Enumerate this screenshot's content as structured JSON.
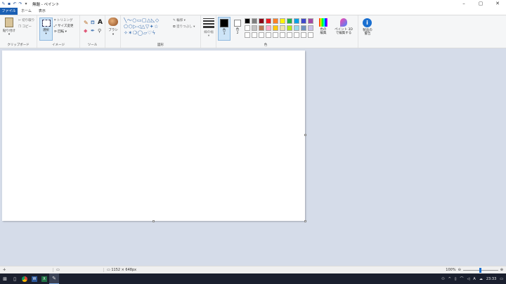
{
  "window": {
    "title": "無題 - ペイント"
  },
  "tabs": {
    "file": "ファイル",
    "home": "ホーム",
    "view": "表示"
  },
  "clipboard": {
    "paste": "貼り付け",
    "cut": "切り取り",
    "copy": "コピー",
    "label": "クリップボード"
  },
  "image": {
    "select": "選択",
    "crop": "トリミング",
    "resize": "サイズ変更",
    "rotate": "回転",
    "label": "イメージ"
  },
  "tools": {
    "label": "ツール"
  },
  "brushes": {
    "label": "ブラシ"
  },
  "shapes": {
    "outline": "輪郭",
    "fill": "塗りつぶし",
    "label": "図形"
  },
  "size": {
    "label": "線の幅"
  },
  "colors": {
    "color1": "色\n1",
    "color2": "色\n2",
    "edit": "色の\n編集",
    "label": "色",
    "color1_value": "#000000",
    "color2_value": "#ffffff",
    "palette_row1": [
      "#000000",
      "#7f7f7f",
      "#880015",
      "#ed1c24",
      "#ff7f27",
      "#fff200",
      "#22b14c",
      "#00a2e8",
      "#3f48cc",
      "#a349a4"
    ],
    "palette_row2": [
      "#ffffff",
      "#c3c3c3",
      "#b97a57",
      "#ffaec9",
      "#ffc90e",
      "#efe4b0",
      "#b5e61d",
      "#99d9ea",
      "#7092be",
      "#c8bfe7"
    ],
    "palette_row3": [
      "#ffffff",
      "#ffffff",
      "#ffffff",
      "#ffffff",
      "#ffffff",
      "#ffffff",
      "#ffffff",
      "#ffffff",
      "#ffffff",
      "#ffffff"
    ]
  },
  "paint3d": {
    "label": "ペイント 3D\nで編集する"
  },
  "product_alert": {
    "label": "製品の\n警告"
  },
  "status": {
    "dimensions": "1152 × 648px",
    "zoom": "100%"
  },
  "taskbar": {
    "time": "23:33",
    "ime": "A"
  }
}
